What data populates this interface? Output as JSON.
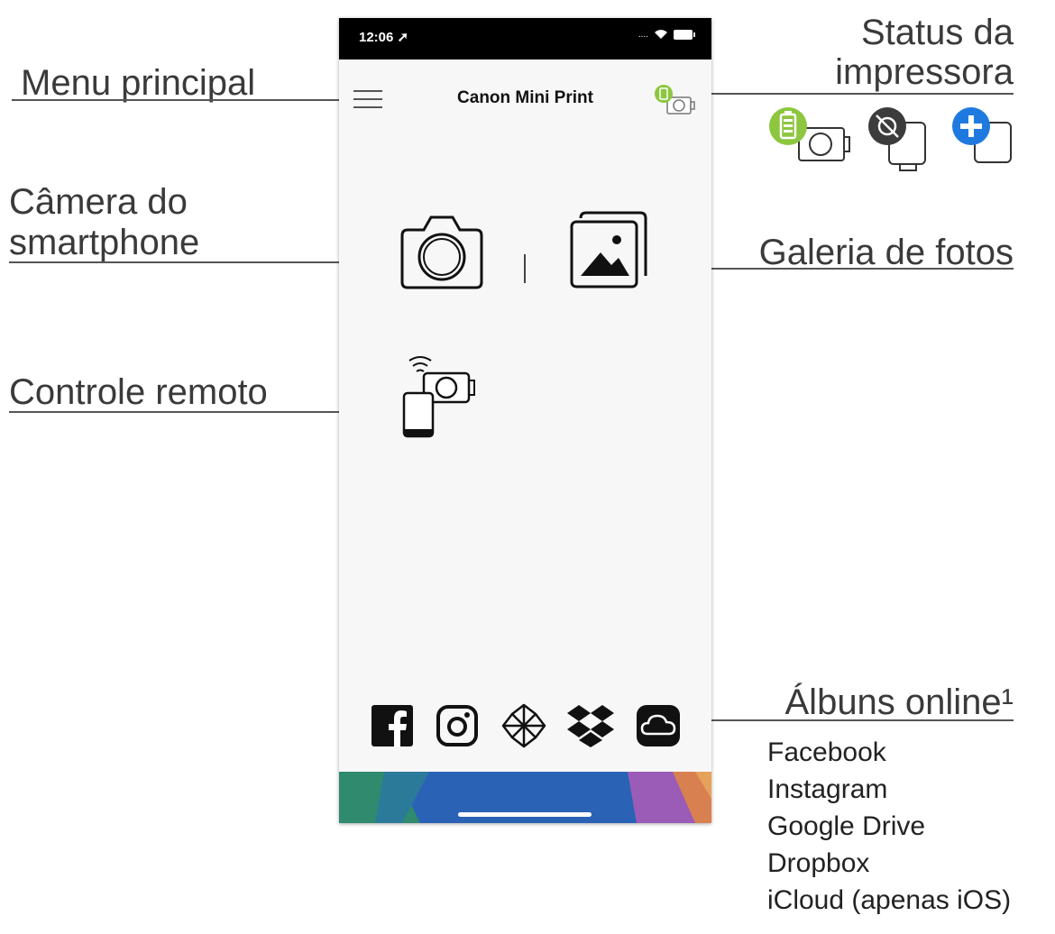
{
  "annotations": {
    "menu_label": "Menu principal",
    "status_label_line1": "Status da",
    "status_label_line2": "impressora",
    "camera_label_line1": "Câmera do",
    "camera_label_line2": "smartphone",
    "gallery_label": "Galeria de fotos",
    "remote_label": "Controle remoto",
    "albums_label": "Álbuns online¹",
    "albums_list": [
      "Facebook",
      "Instagram",
      "Google Drive",
      "Dropbox",
      "iCloud (apenas iOS)"
    ]
  },
  "status_icons": [
    "battery-camera-icon",
    "disconnected-printer-icon",
    "add-printer-icon"
  ],
  "phone": {
    "status_bar": {
      "time": "12:06",
      "signal": "...."
    },
    "header": {
      "title": "Canon Mini Print"
    },
    "main_actions": [
      "camera-icon",
      "gallery-icon",
      "remote-control-icon"
    ],
    "online_albums": [
      "facebook-icon",
      "instagram-icon",
      "google-drive-icon",
      "dropbox-icon",
      "icloud-icon"
    ]
  },
  "colors": {
    "battery_green": "#8dc63f",
    "add_blue": "#1f7ae0",
    "disconnected_dark": "#3c3c3c",
    "footer_gradient": [
      "#2f8f72",
      "#2a61b4",
      "#3a6fc0",
      "#c85aa0",
      "#e08a50"
    ]
  }
}
